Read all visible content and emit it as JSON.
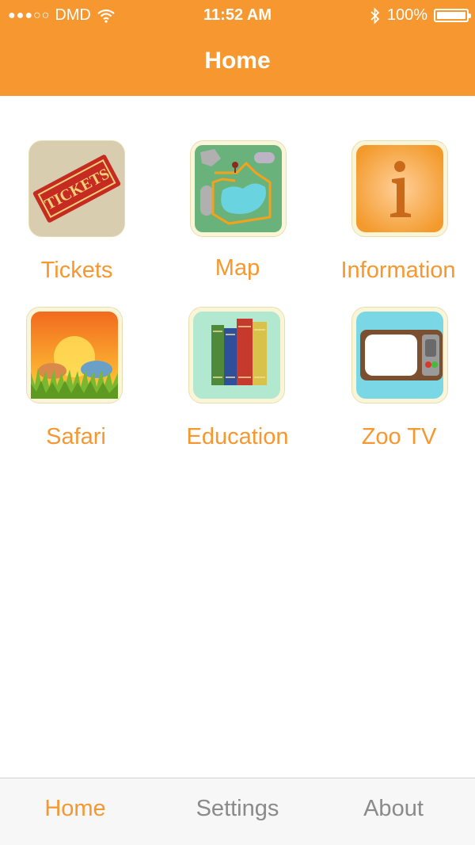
{
  "status_bar": {
    "signal": "●●●○○",
    "carrier": "DMD",
    "time": "11:52 AM",
    "battery": "100%"
  },
  "nav": {
    "title": "Home"
  },
  "tiles": [
    {
      "label": "Tickets",
      "icon": "tickets-icon"
    },
    {
      "label": "Map",
      "icon": "map-icon"
    },
    {
      "label": "Information",
      "icon": "information-icon"
    },
    {
      "label": "Safari",
      "icon": "safari-icon"
    },
    {
      "label": "Education",
      "icon": "education-icon"
    },
    {
      "label": "Zoo TV",
      "icon": "zoo-tv-icon"
    }
  ],
  "tabbar": {
    "items": [
      {
        "label": "Home",
        "active": true
      },
      {
        "label": "Settings",
        "active": false
      },
      {
        "label": "About",
        "active": false
      }
    ]
  },
  "colors": {
    "accent": "#f7972f",
    "tab_inactive": "#8a8a8a"
  }
}
